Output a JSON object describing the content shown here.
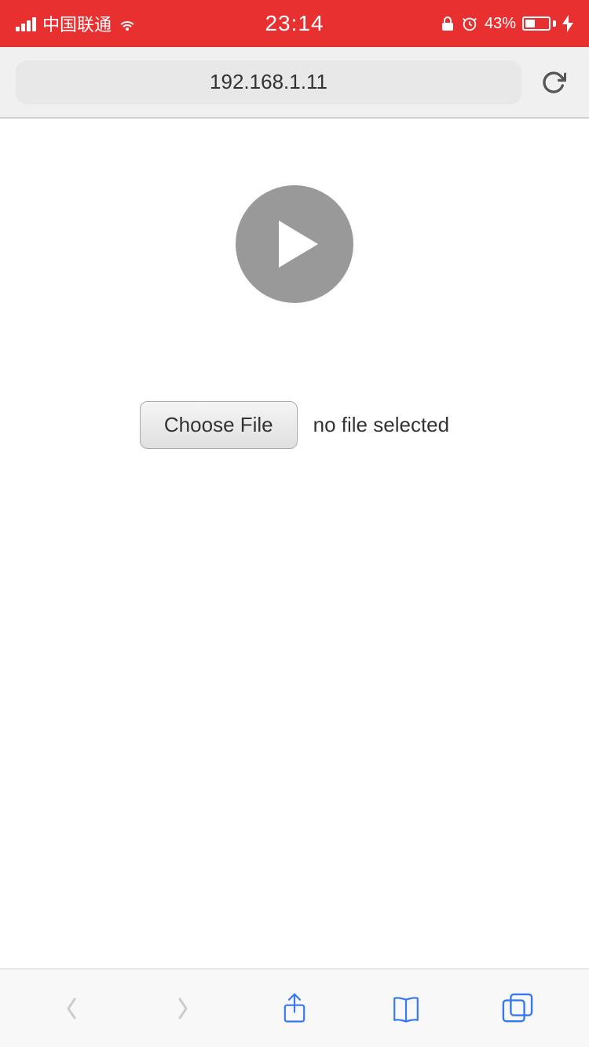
{
  "statusBar": {
    "carrier": "中国联通",
    "time": "23:14",
    "battery": "43%"
  },
  "browserBar": {
    "url": "192.168.1.11",
    "reloadIcon": "reload-icon"
  },
  "page": {
    "playIcon": "play-icon",
    "fileInput": {
      "buttonLabel": "Choose File",
      "noFileText": "no file selected"
    }
  },
  "bottomToolbar": {
    "backLabel": "‹",
    "forwardLabel": "›",
    "shareIcon": "share-icon",
    "bookmarkIcon": "bookmark-icon",
    "tabsIcon": "tabs-icon"
  }
}
